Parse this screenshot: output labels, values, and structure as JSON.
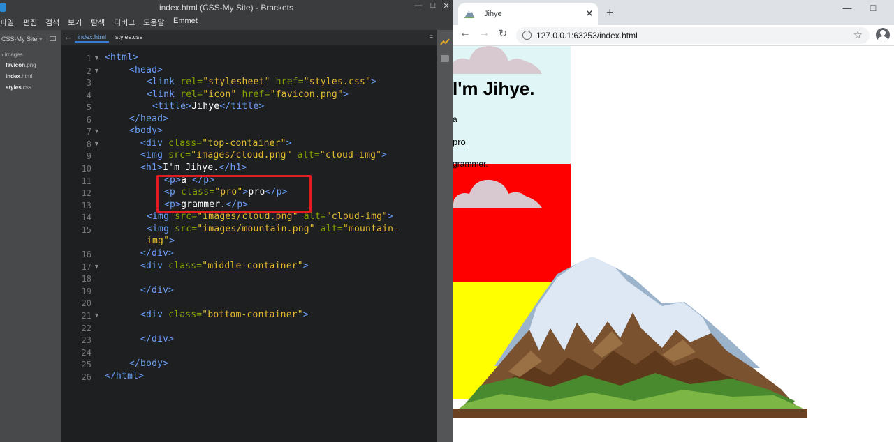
{
  "brackets": {
    "title": "index.html (CSS-My Site) - Brackets",
    "menu": [
      "파일",
      "편집",
      "검색",
      "보기",
      "탐색",
      "디버그",
      "도움말",
      "Emmet"
    ],
    "project": "CSS-My Site",
    "tree": {
      "folder": "images",
      "files": [
        {
          "name": "favicon",
          "ext": ".png"
        },
        {
          "name": "index",
          "ext": ".html"
        },
        {
          "name": "styles",
          "ext": ".css"
        }
      ]
    },
    "tabs": [
      "index.html",
      "styles.css"
    ],
    "line_numbers": [
      "1",
      "2",
      "3",
      "4",
      "5",
      "6",
      "7",
      "8",
      "9",
      "10",
      "11",
      "12",
      "13",
      "14",
      "15",
      "",
      "16",
      "17",
      "18",
      "19",
      "20",
      "21",
      "22",
      "23",
      "24",
      "25",
      "26"
    ],
    "code": {
      "l1": "<html>",
      "l2": "<head>",
      "l3_tag": "<link",
      "l3_a1": " rel=",
      "l3_v1": "\"stylesheet\"",
      "l3_a2": " href=",
      "l3_v2": "\"styles.css\"",
      "l3_end": ">",
      "l4_tag": "<link",
      "l4_a1": " rel=",
      "l4_v1": "\"icon\"",
      "l4_a2": " href=",
      "l4_v2": "\"favicon.png\"",
      "l4_end": ">",
      "l5_open": "<title>",
      "l5_text": "Jihye",
      "l5_close": "</title>",
      "l6": "</head>",
      "l7": "<body>",
      "l8_tag": "<div",
      "l8_a": " class=",
      "l8_v": "\"top-container\"",
      "l8_end": ">",
      "l9_tag": "<img",
      "l9_a1": " src=",
      "l9_v1": "\"images/cloud.png\"",
      "l9_a2": " alt=",
      "l9_v2": "\"cloud-img\"",
      "l9_end": ">",
      "l10_open": "<h1>",
      "l10_text": "I'm Jihye.",
      "l10_close": "</h1>",
      "l11_open": "<p>",
      "l11_text": "a ",
      "l11_close": "</p>",
      "l12_tag": "<p",
      "l12_a": " class=",
      "l12_v": "\"pro\"",
      "l12_end": ">",
      "l12_text": "pro",
      "l12_close": "</p>",
      "l13_open": "<p>",
      "l13_text": "grammer.",
      "l13_close": "</p>",
      "l14_tag": "<img",
      "l14_a1": " src=",
      "l14_v1": "\"images/cloud.png\"",
      "l14_a2": " alt=",
      "l14_v2": "\"cloud-img\"",
      "l14_end": ">",
      "l15_tag": "<img",
      "l15_a1": " src=",
      "l15_v1": "\"images/mountain.png\"",
      "l15_a2": " alt=",
      "l15_v2a": "\"mountain-",
      "l15_v2b": "img\"",
      "l15_end": ">",
      "l16": "</div>",
      "l17_tag": "<div",
      "l17_a": " class=",
      "l17_v": "\"middle-container\"",
      "l17_end": ">",
      "l19": "</div>",
      "l21_tag": "<div",
      "l21_a": " class=",
      "l21_v": "\"bottom-container\"",
      "l21_end": ">",
      "l23": "</div>",
      "l25": "</body>",
      "l26": "</html>"
    }
  },
  "chrome": {
    "tab_title": "Jihye",
    "url": "127.0.0.1:63253/index.html",
    "page": {
      "h1": "I'm Jihye.",
      "p1": "a",
      "p2": "pro",
      "p3": "grammer."
    }
  },
  "colors": {
    "top_container": "#e0f6f6",
    "middle_container": "#ff0000",
    "bottom_container": "#ffff00",
    "highlight_box": "#e31b23"
  },
  "icons": {
    "menu_back": "arrow-left-icon",
    "split_view": "split-icon",
    "live_preview": "lightning-icon",
    "extension_manager": "extension-icon"
  }
}
